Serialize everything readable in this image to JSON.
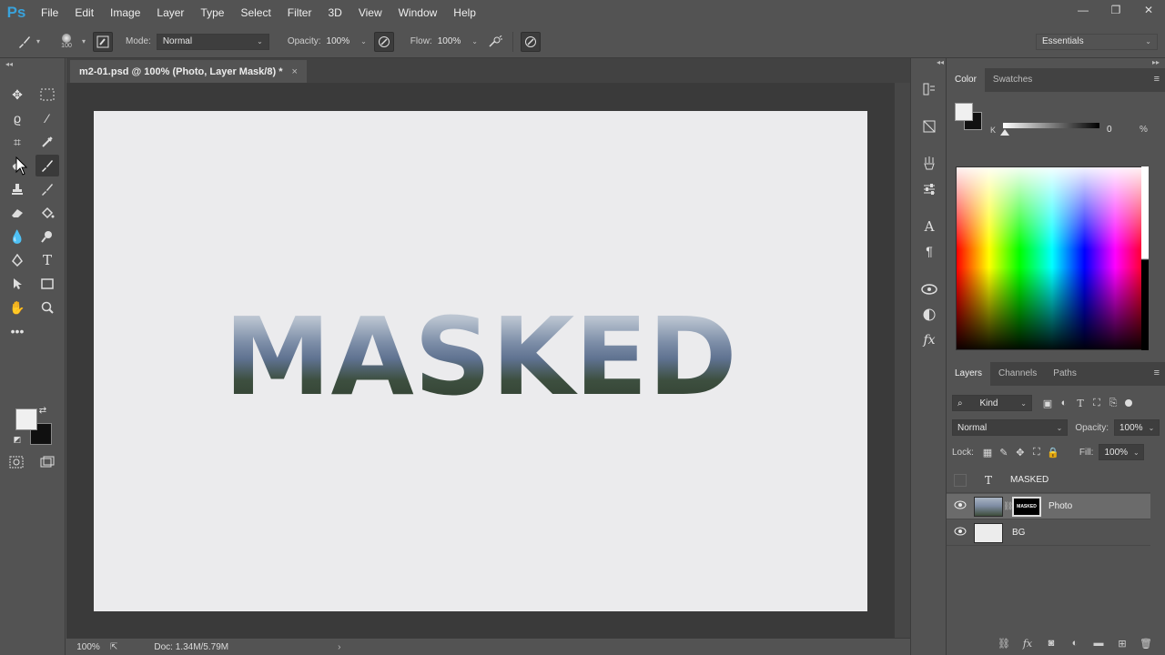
{
  "app": {
    "logo": "Ps"
  },
  "menu": [
    "File",
    "Edit",
    "Image",
    "Layer",
    "Type",
    "Select",
    "Filter",
    "3D",
    "View",
    "Window",
    "Help"
  ],
  "window_controls": {
    "minimize": "—",
    "restore": "❐",
    "close": "✕"
  },
  "options": {
    "brush_size": "100",
    "mode_label": "Mode:",
    "mode_value": "Normal",
    "opacity_label": "Opacity:",
    "opacity_value": "100%",
    "flow_label": "Flow:",
    "flow_value": "100%",
    "workspace": "Essentials"
  },
  "document": {
    "tab_title": "m2-01.psd @ 100% (Photo, Layer Mask/8) *",
    "tab_close": "×",
    "canvas_text": "MASKED",
    "canvas_bg": "#ebebed"
  },
  "status": {
    "zoom": "100%",
    "doc": "Doc: 1.34M/5.79M",
    "arrow": "›"
  },
  "color_panel": {
    "tabs": [
      "Color",
      "Swatches"
    ],
    "k_label": "K",
    "k_value": "0",
    "k_unit": "%",
    "fg_color": "#f0f0f0",
    "bg_color": "#111111"
  },
  "layers_panel": {
    "tabs": [
      "Layers",
      "Channels",
      "Paths"
    ],
    "kind_label": "Kind",
    "blend_mode": "Normal",
    "opacity_label": "Opacity:",
    "opacity_value": "100%",
    "lock_label": "Lock:",
    "fill_label": "Fill:",
    "fill_value": "100%",
    "layers": [
      {
        "name": "MASKED",
        "type": "text",
        "visible": false
      },
      {
        "name": "Photo",
        "type": "image-with-mask",
        "visible": true,
        "selected": true,
        "mask_text": "MASKED"
      },
      {
        "name": "BG",
        "type": "fill",
        "visible": true
      }
    ]
  },
  "icons": {
    "eye": "👁",
    "menu": "≡",
    "collapse": "◂◂",
    "expand": "▸▸"
  }
}
